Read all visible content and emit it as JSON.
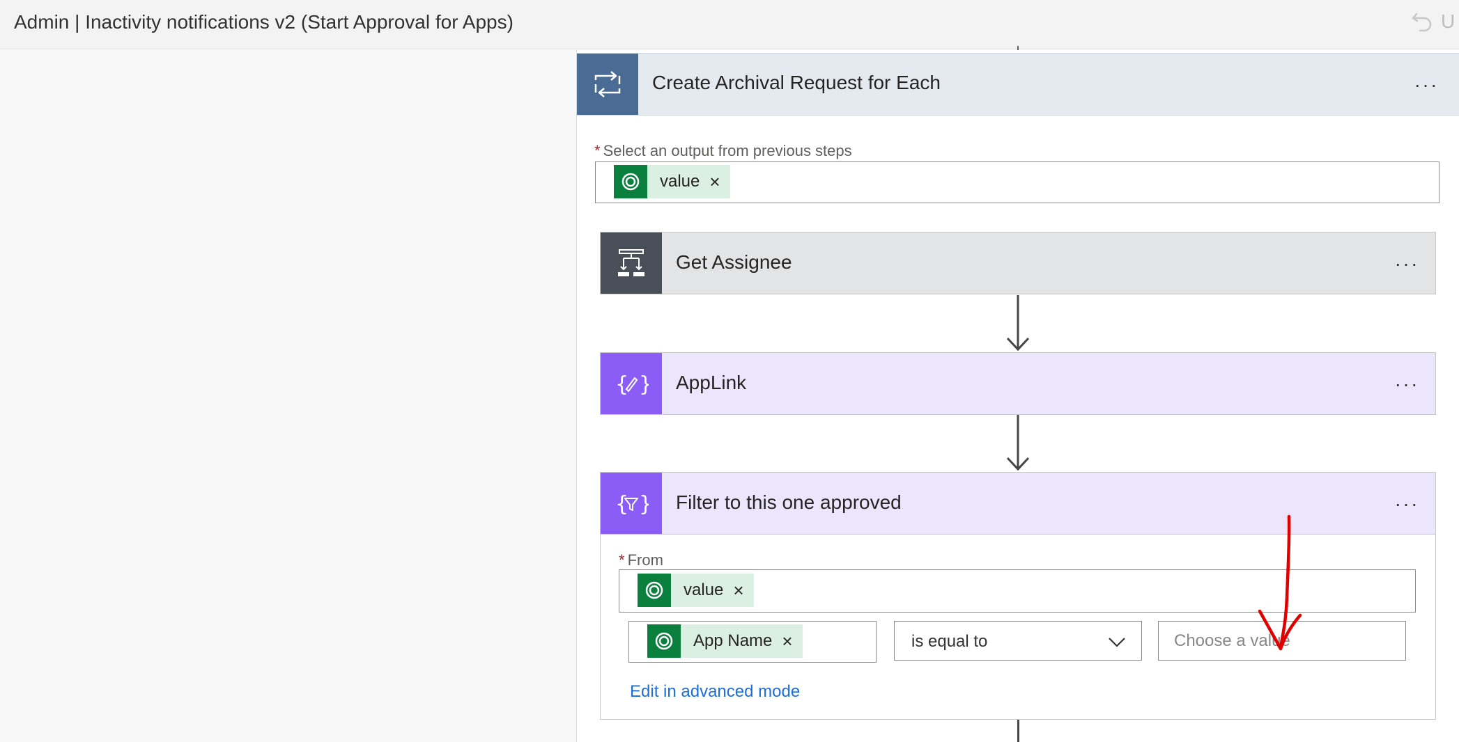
{
  "window": {
    "title": "Admin | Inactivity notifications v2 (Start Approval for Apps)",
    "truncated_right": "U"
  },
  "foreach": {
    "title": "Create Archival Request for Each",
    "more_label": "...",
    "output_label": "Select an output from previous steps",
    "required_mark": "*",
    "output_token": {
      "label": "value",
      "remove": "×"
    }
  },
  "actions": [
    {
      "title": "Get Assignee",
      "more_label": "...",
      "icon": "get-assignee-icon"
    },
    {
      "title": "AppLink",
      "more_label": "...",
      "icon": "variable-icon"
    },
    {
      "title": "Filter to this one approved",
      "more_label": "...",
      "icon": "filter-array-icon"
    }
  ],
  "filter": {
    "from_label": "From",
    "required_mark": "*",
    "from_token": {
      "label": "value",
      "remove": "×"
    },
    "condition_left_token": {
      "label": "App Name",
      "remove": "×"
    },
    "operator": "is equal to",
    "value_placeholder": "Choose a value",
    "advanced_link": "Edit in advanced mode"
  },
  "colors": {
    "foreach_icon_bg": "#4a6b94",
    "assignee_icon_bg": "#484f58",
    "variable_icon_bg": "#8b5cf6",
    "variable_header_bg": "#ebe6fc",
    "dataverse_green": "#0b7f3e",
    "annotation_red": "#e00000"
  }
}
